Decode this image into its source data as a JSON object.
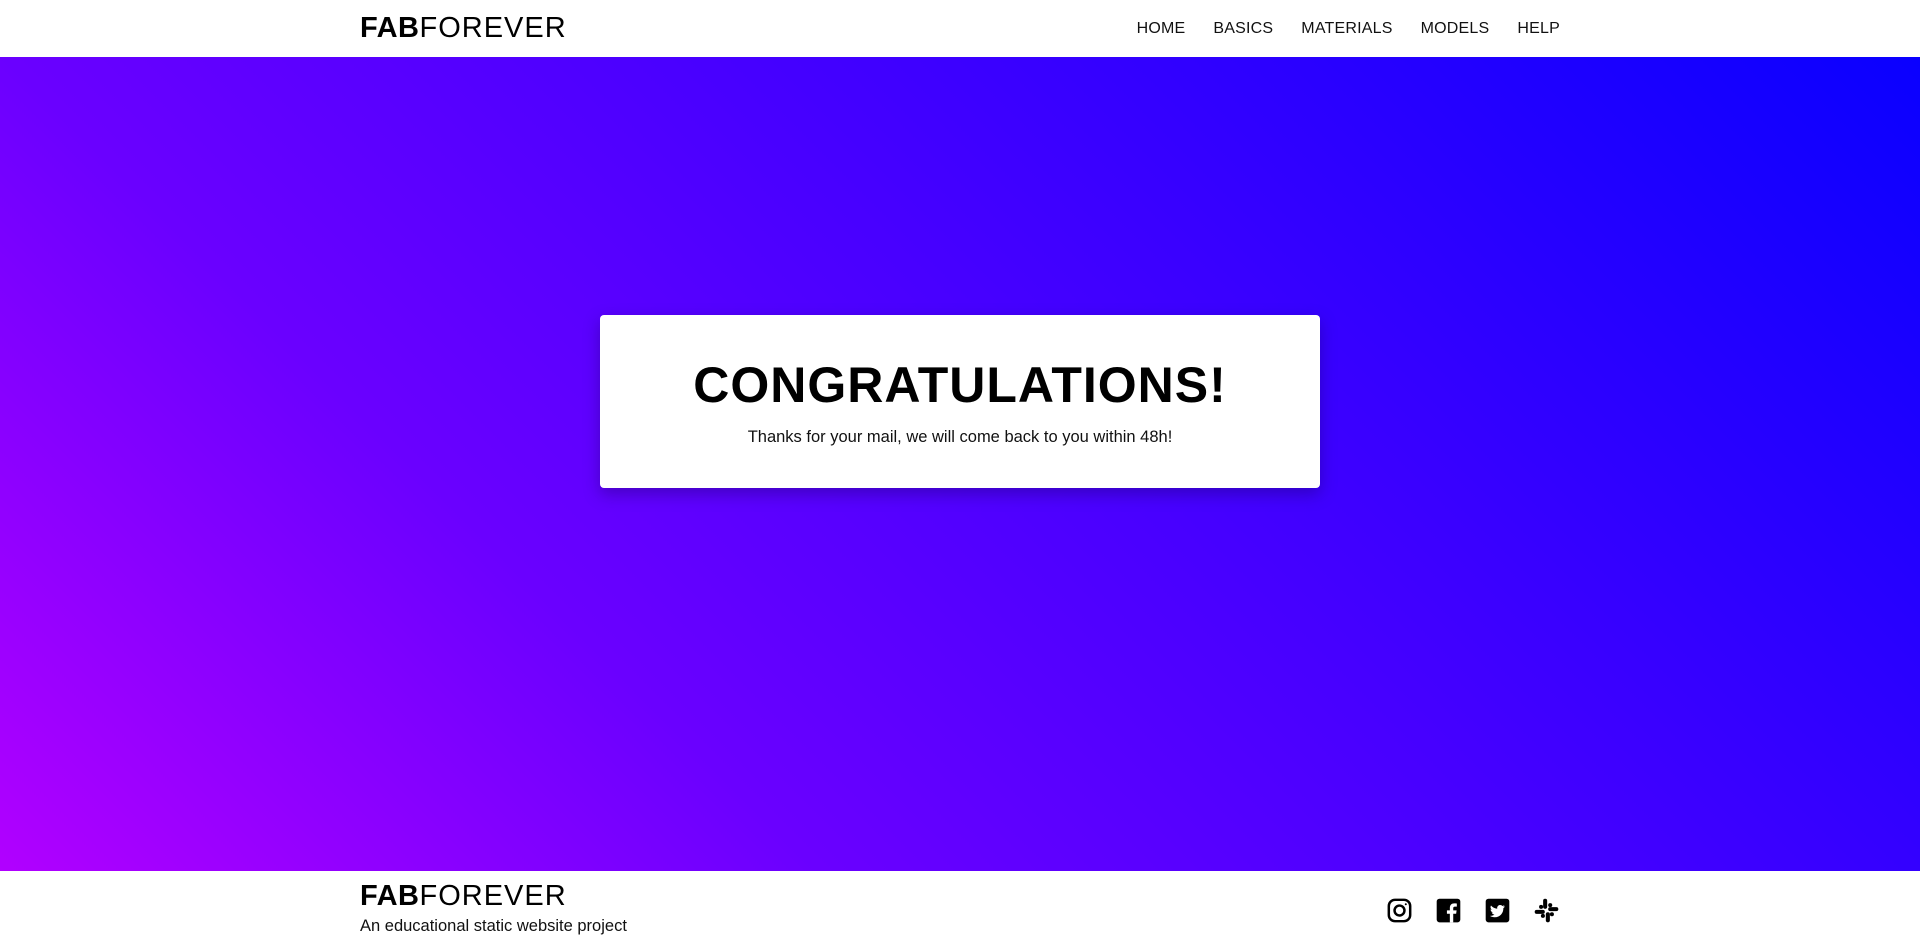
{
  "header": {
    "logo_bold": "FAB",
    "logo_light": "FOREVER",
    "nav": [
      {
        "label": "HOME"
      },
      {
        "label": "BASICS"
      },
      {
        "label": "MATERIALS"
      },
      {
        "label": "MODELS"
      },
      {
        "label": "HELP"
      }
    ]
  },
  "hero": {
    "gradient": [
      "#b100ff",
      "#6a00ff",
      "#3b00ff",
      "#0a00ff"
    ],
    "card": {
      "title": "CONGRATULATIONS!",
      "message": "Thanks for your mail, we will come back to you within 48h!"
    }
  },
  "footer": {
    "logo_bold": "FAB",
    "logo_light": "FOREVER",
    "tagline": "An educational static website project",
    "socials": [
      {
        "icon": "instagram-icon"
      },
      {
        "icon": "facebook-icon"
      },
      {
        "icon": "twitter-icon"
      },
      {
        "icon": "slack-icon"
      }
    ]
  }
}
